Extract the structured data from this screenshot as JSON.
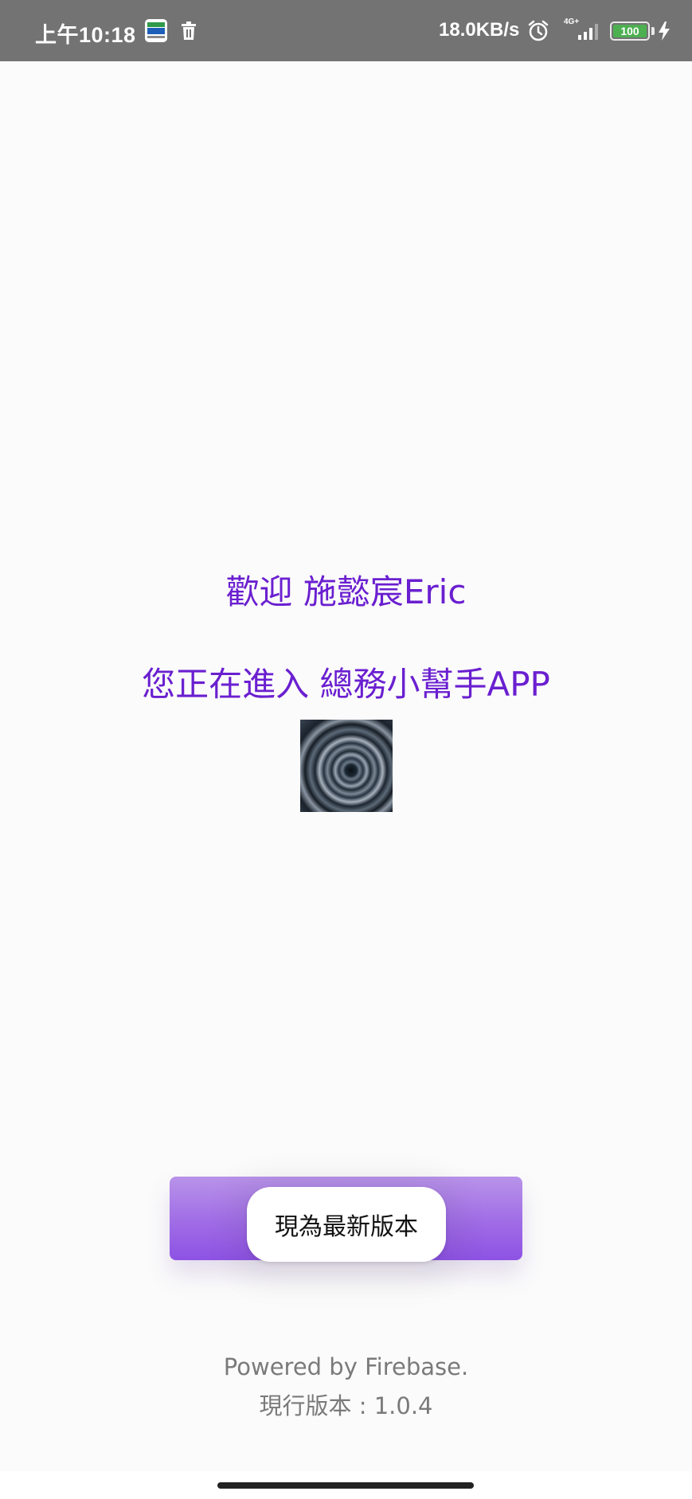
{
  "status_bar": {
    "time": "上午10:18",
    "net_speed": "18.0KB/s",
    "net_type": "4G+",
    "battery_level": "100",
    "icons": [
      "app-notification-icon",
      "trash-icon",
      "alarm-icon",
      "signal-icon",
      "battery-icon",
      "charging-icon"
    ]
  },
  "main": {
    "welcome_text": "歡迎 施懿宸Eric",
    "entering_text": "您正在進入 總務小幫手APP",
    "avatar": "avatar-image"
  },
  "toast": {
    "message": "現為最新版本"
  },
  "footer": {
    "powered_by": "Powered by Firebase.",
    "version": "現行版本 : 1.0.4"
  },
  "colors": {
    "accent": "#6a1fd0",
    "button": "#a06ce6",
    "status_bar": "#737373"
  }
}
